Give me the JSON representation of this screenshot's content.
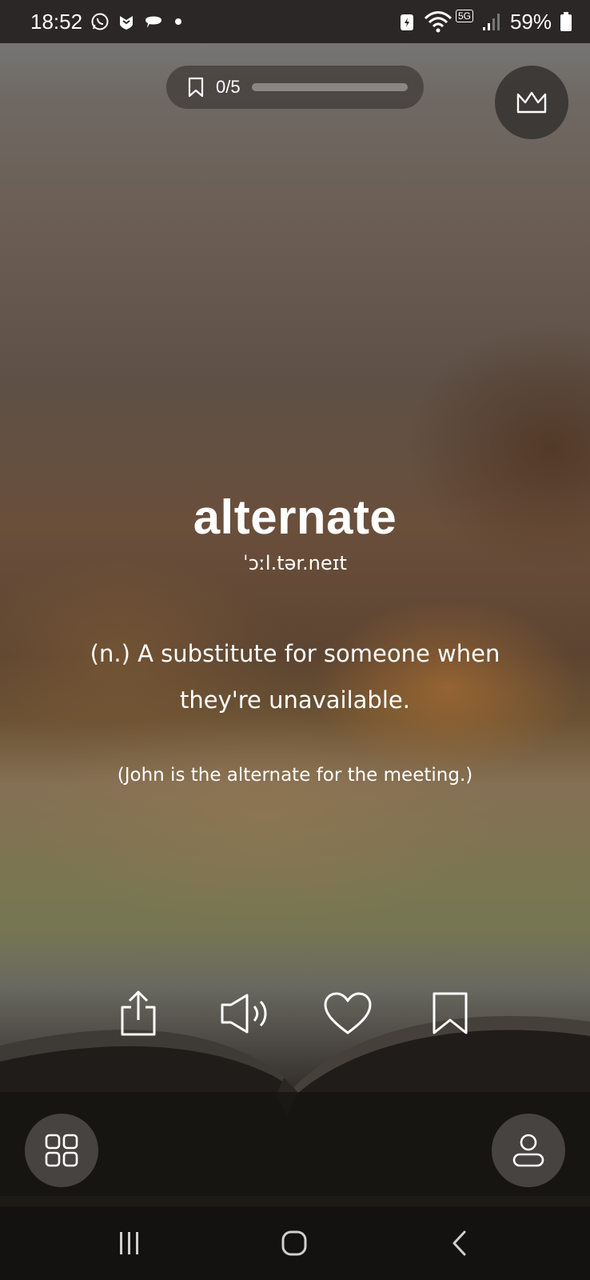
{
  "status_bar": {
    "time": "18:52",
    "battery": "59%",
    "network": "5G",
    "notification_icons": [
      "whatsapp-icon",
      "mcafee-icon",
      "chat-bubble-icon",
      "dot-icon"
    ],
    "system_icons": [
      "battery-saver-icon",
      "wifi-icon",
      "signal-icon",
      "battery-icon"
    ]
  },
  "progress": {
    "count": "0/5",
    "fraction": 0.0
  },
  "word_card": {
    "word": "alternate",
    "phonetic": "ˈɔːl.tər.neɪt",
    "definition": "(n.) A substitute for someone when they're unavailable.",
    "example": "(John is the alternate for the meeting.)"
  },
  "actions": [
    "share-icon",
    "speaker-icon",
    "heart-icon",
    "bookmark-icon"
  ],
  "bottom_buttons": [
    "grid-icon",
    "profile-icon"
  ],
  "nav_bar": [
    "recents-icon",
    "home-icon",
    "back-icon"
  ]
}
